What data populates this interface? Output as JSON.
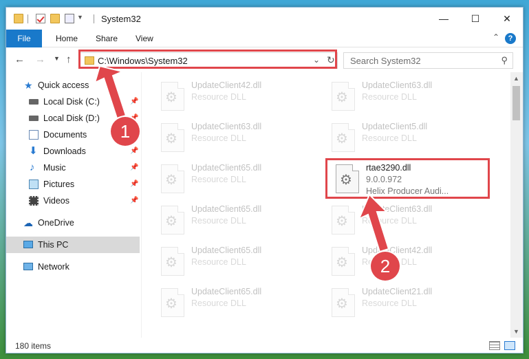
{
  "window": {
    "title": "System32",
    "minimize_icon": "minimize-icon",
    "maximize_icon": "maximize-icon",
    "close_icon": "close-icon"
  },
  "ribbon": {
    "tabs": [
      "File",
      "Home",
      "Share",
      "View"
    ],
    "help": "?"
  },
  "address": {
    "path": "C:\\Windows\\System32",
    "search_placeholder": "Search System32"
  },
  "sidebar": {
    "items": [
      {
        "label": "Quick access",
        "icon": "star-icon"
      },
      {
        "label": "Local Disk (C:)",
        "icon": "drive-icon",
        "pinned": true
      },
      {
        "label": "Local Disk (D:)",
        "icon": "drive-icon",
        "pinned": true
      },
      {
        "label": "Documents",
        "icon": "documents-icon",
        "pinned": true
      },
      {
        "label": "Downloads",
        "icon": "download-icon",
        "pinned": true
      },
      {
        "label": "Music",
        "icon": "music-icon",
        "pinned": true
      },
      {
        "label": "Pictures",
        "icon": "pictures-icon",
        "pinned": true
      },
      {
        "label": "Videos",
        "icon": "videos-icon",
        "pinned": true
      },
      {
        "label": "OneDrive",
        "icon": "cloud-icon"
      },
      {
        "label": "This PC",
        "icon": "computer-icon",
        "selected": true
      },
      {
        "label": "Network",
        "icon": "network-icon"
      }
    ]
  },
  "files": {
    "left": [
      {
        "name": "UpdateClient42.dll",
        "type": "Resource DLL"
      },
      {
        "name": "UpdateClient63.dll",
        "type": "Resource DLL"
      },
      {
        "name": "UpdateClient65.dll",
        "type": "Resource DLL"
      },
      {
        "name": "UpdateClient65.dll",
        "type": "Resource DLL"
      },
      {
        "name": "UpdateClient65.dll",
        "type": "Resource DLL"
      },
      {
        "name": "UpdateClient65.dll",
        "type": "Resource DLL"
      }
    ],
    "right": [
      {
        "name": "UpdateClient63.dll",
        "type": "Resource DLL"
      },
      {
        "name": "UpdateClient5.dll",
        "type": "Resource DLL"
      },
      {
        "name": "rtae3290.dll",
        "version": "9.0.0.972",
        "description": "Helix Producer Audi..."
      },
      {
        "name": "UpdateClient63.dll",
        "type": "Resource DLL"
      },
      {
        "name": "UpdateClient42.dll",
        "type": "Resource DLL"
      },
      {
        "name": "UpdateClient21.dll",
        "type": "Resource DLL"
      }
    ]
  },
  "status": {
    "item_count": "180 items"
  },
  "annotations": {
    "step1": "1",
    "step2": "2",
    "highlight_color": "#e0464b"
  }
}
